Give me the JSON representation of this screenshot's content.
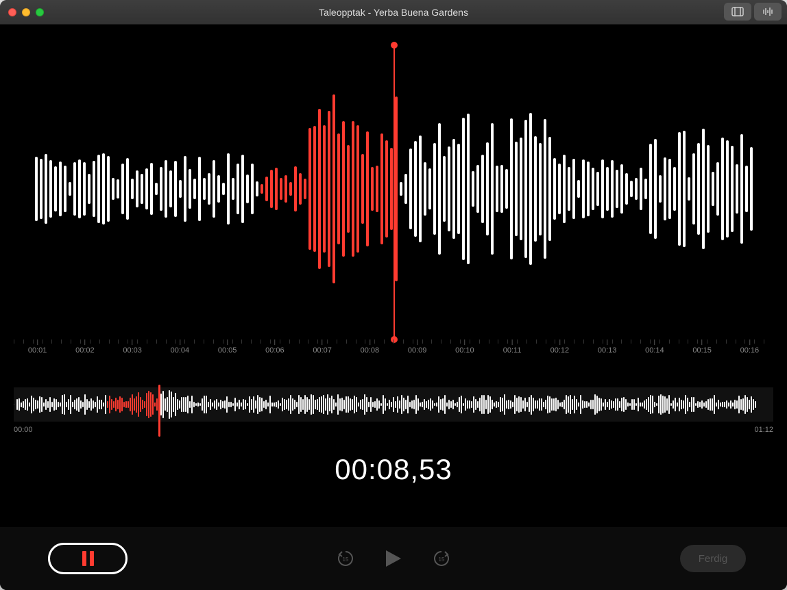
{
  "window": {
    "title": "Taleopptak - Yerba Buena Gardens"
  },
  "toolbar": {
    "trim_icon": "trim-icon",
    "enhance_icon": "enhance-icon"
  },
  "waveform_main": {
    "playhead_position_percent": 50,
    "red_segment": {
      "start_percent": 31,
      "end_percent": 50
    },
    "timeline_ticks": [
      "00:01",
      "00:02",
      "00:03",
      "00:04",
      "00:05",
      "00:06",
      "00:07",
      "00:08",
      "00:09",
      "00:10",
      "00:11",
      "00:12",
      "00:13",
      "00:14",
      "00:15",
      "00:16"
    ]
  },
  "overview": {
    "start_label": "00:00",
    "end_label": "01:12",
    "playhead_position_percent": 19,
    "red_segment": {
      "start_percent": 12,
      "end_percent": 19
    }
  },
  "time_display": "00:08,53",
  "controls": {
    "record_state": "pause",
    "skip_back_icon": "skip-back-15-icon",
    "play_icon": "play-icon",
    "skip_forward_icon": "skip-forward-15-icon",
    "done_label": "Ferdig"
  },
  "colors": {
    "accent_red": "#ff3b30",
    "bg_black": "#000000",
    "text_muted": "#888888"
  }
}
